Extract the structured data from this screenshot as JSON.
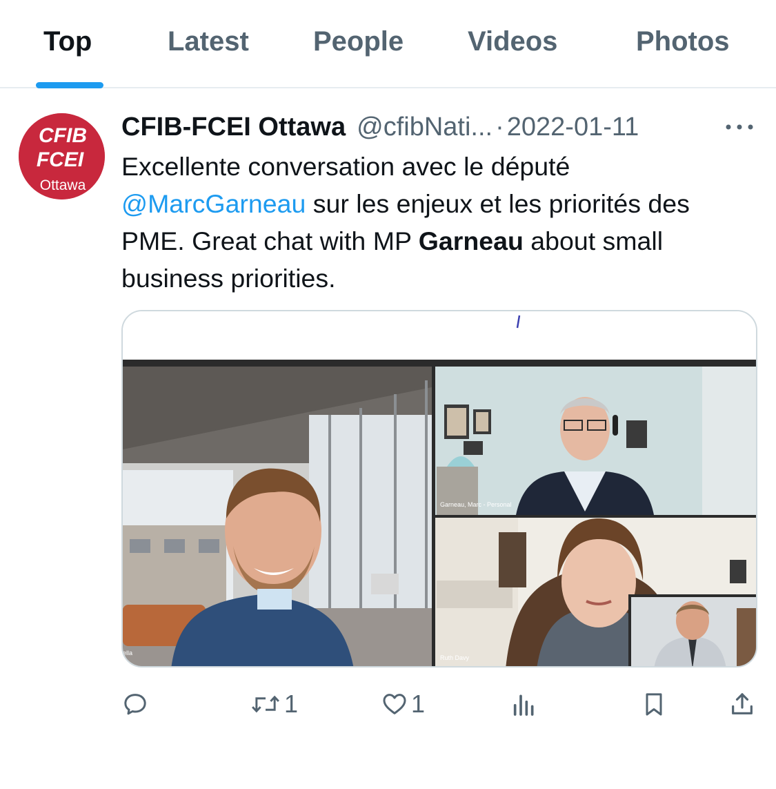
{
  "tabs": [
    {
      "label": "Top",
      "active": true
    },
    {
      "label": "Latest",
      "active": false
    },
    {
      "label": "People",
      "active": false
    },
    {
      "label": "Videos",
      "active": false
    },
    {
      "label": "Photos",
      "active": false
    }
  ],
  "tweet": {
    "avatar": {
      "line1": "CFIB",
      "line2": "FCEI",
      "line3": "Ottawa",
      "color": "#c8283d"
    },
    "display_name": "CFIB-FCEI Ottawa",
    "handle": "@cfibNati...",
    "separator": "·",
    "date": "2022-01-11",
    "text_part1": "Excellente conversation avec le député ",
    "mention": "@MarcGarneau",
    "text_part2": " sur les enjeux et les priorités des PME. Great chat with MP ",
    "bold_name": "Garneau",
    "text_part3": " about small business priorities.",
    "media": {
      "tile_label_top_right": "Garneau, Marc - Personal",
      "tile_label_bottom": "Ruth Davy",
      "tile_label_left": "ella"
    },
    "actions": {
      "reply_icon": "reply-icon",
      "retweet_count": "1",
      "like_count": "1",
      "views_icon": "views-icon",
      "bookmark_icon": "bookmark-icon",
      "share_icon": "share-icon"
    }
  },
  "colors": {
    "accent": "#1d9bf0",
    "secondary_text": "#536471",
    "brand_red": "#c8283d"
  }
}
